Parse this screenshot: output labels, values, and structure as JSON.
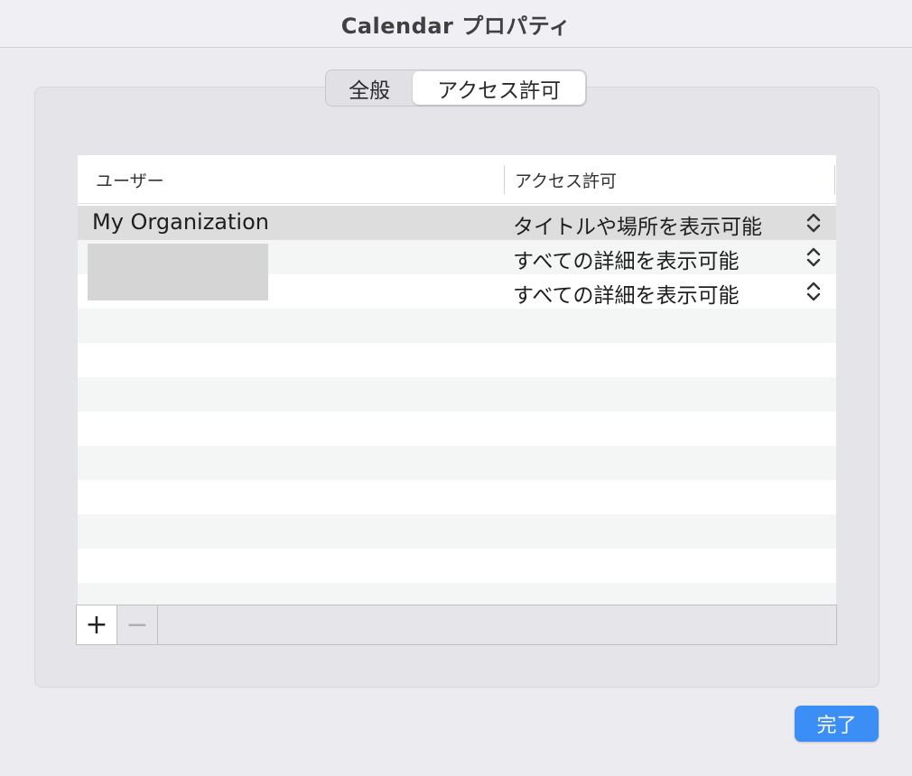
{
  "window": {
    "title": "Calendar プロパティ"
  },
  "tabs": [
    {
      "label": "全般",
      "selected": false
    },
    {
      "label": "アクセス許可",
      "selected": true
    }
  ],
  "table": {
    "headers": {
      "user": "ユーザー",
      "access": "アクセス許可"
    },
    "rows": [
      {
        "user": "My Organization",
        "permission": "タイトルや場所を表示可能",
        "selected": true
      },
      {
        "user": "",
        "permission": "すべての詳細を表示可能",
        "selected": false
      },
      {
        "user": "",
        "permission": "すべての詳細を表示可能",
        "selected": false
      }
    ]
  },
  "bottom_bar": {
    "add_symbol": "+",
    "remove_symbol": "−"
  },
  "footer": {
    "done_label": "完了"
  },
  "colors": {
    "accent": "#3b8ef5",
    "selected_row": "#dddddd",
    "stripe": "#f4f5f5"
  }
}
